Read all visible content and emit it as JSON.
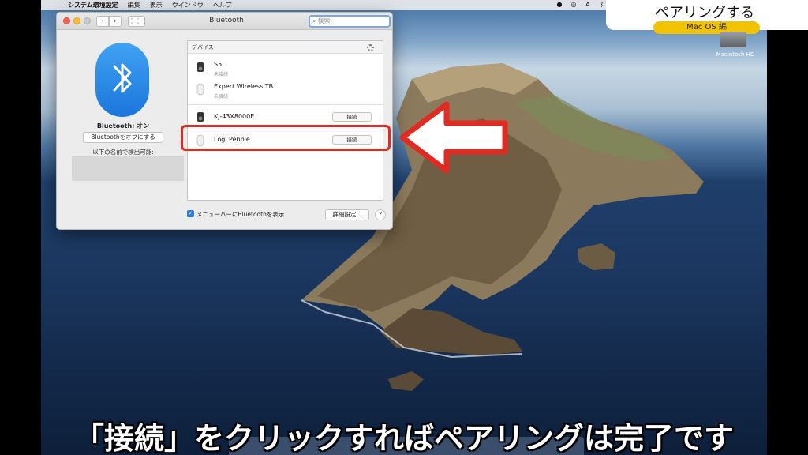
{
  "menubar": {
    "app_name": "システム環境設定",
    "items": [
      "編集",
      "表示",
      "ウインドウ",
      "ヘルプ"
    ]
  },
  "video": {
    "title": "ペアリングする",
    "badge": "Mac OS 編",
    "caption": "「接続」をクリックすればペアリングは完了です",
    "accent_color": "#e02a22"
  },
  "desktop": {
    "hd_label": "Macintosh HD"
  },
  "window": {
    "title": "Bluetooth",
    "search_placeholder": "検索"
  },
  "bluetooth": {
    "status": "Bluetooth: オン",
    "toggle_label": "Bluetoothをオフにする",
    "discoverable_label": "以下の名前で検出可能:"
  },
  "devices": {
    "header": "デバイス",
    "connect_label": "接続",
    "items": [
      {
        "name": "S5",
        "sub": "未接続",
        "icon": "speaker-icon"
      },
      {
        "name": "Expert Wireless TB",
        "sub": "未接続",
        "icon": "mouse-icon"
      },
      {
        "name": "KJ-43X8000E",
        "sub": "",
        "icon": "speaker-icon"
      },
      {
        "name": "Logi Pebble",
        "sub": "",
        "icon": "mouse-icon"
      }
    ]
  },
  "footer": {
    "show_in_menubar": "メニューバーにBluetoothを表示",
    "advanced": "詳細設定...",
    "help": "?"
  }
}
